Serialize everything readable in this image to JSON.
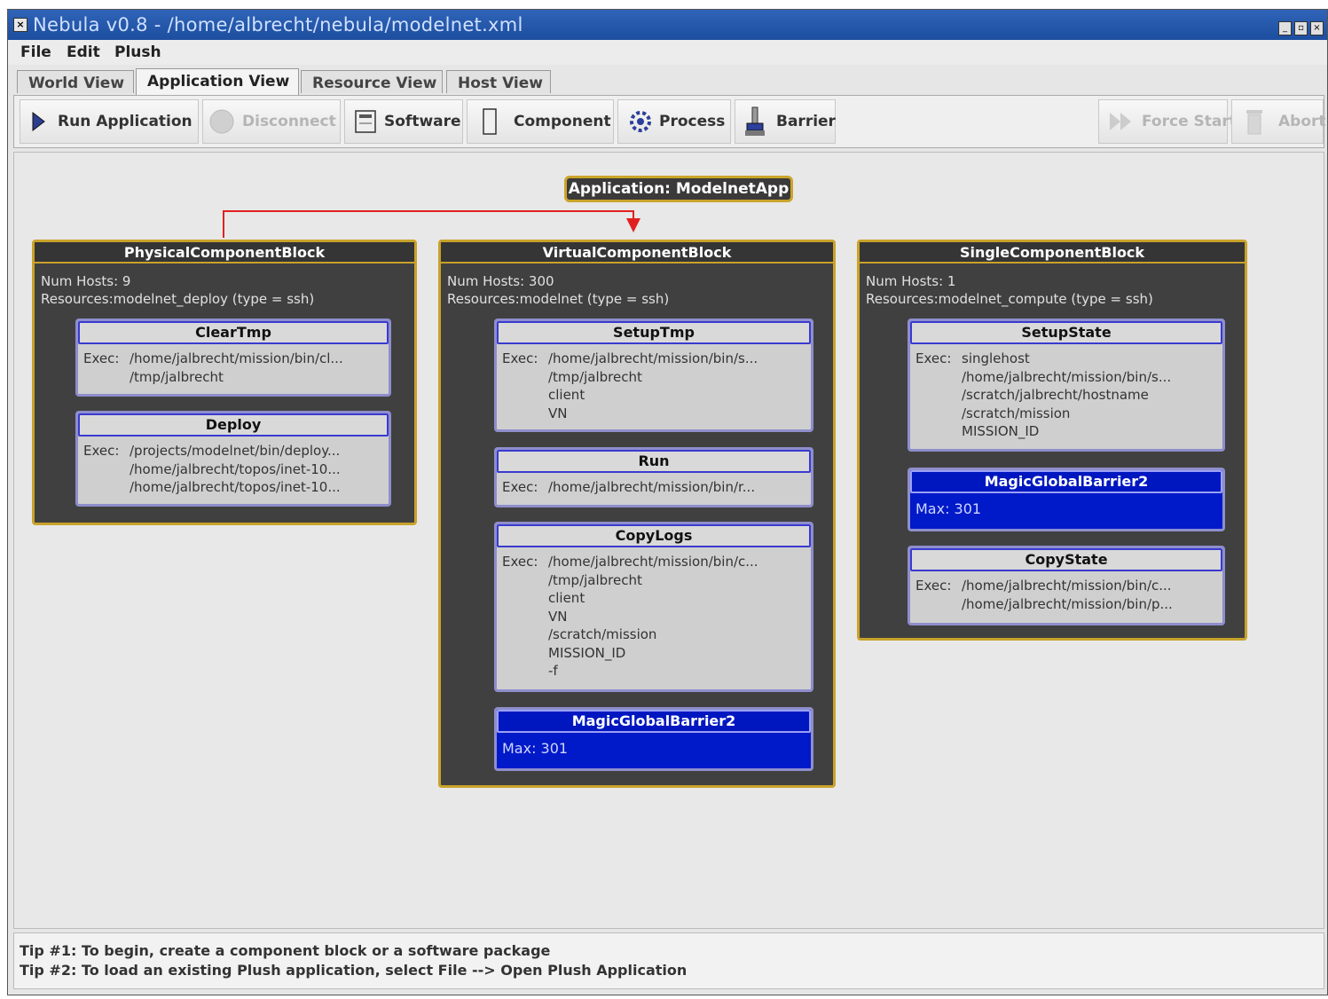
{
  "window": {
    "title": "Nebula v0.8 - /home/albrecht/nebula/modelnet.xml",
    "controls": [
      "_",
      "▫",
      "×"
    ]
  },
  "menu": [
    "File",
    "Edit",
    "Plush"
  ],
  "tabs": [
    {
      "label": "World View",
      "active": false
    },
    {
      "label": "Application View",
      "active": true
    },
    {
      "label": "Resource View",
      "active": false
    },
    {
      "label": "Host View",
      "active": false
    }
  ],
  "toolbar": {
    "run": {
      "label": "Run Application",
      "icon": "play-icon"
    },
    "disconnect": {
      "label": "Disconnect",
      "icon": "disconnect-icon"
    },
    "software": {
      "label": "Software",
      "icon": "software-icon"
    },
    "component": {
      "label": "Component",
      "icon": "component-icon"
    },
    "process": {
      "label": "Process",
      "icon": "gears-icon"
    },
    "barrier": {
      "label": "Barrier",
      "icon": "barrier-icon"
    },
    "force_start": {
      "label": "Force Start",
      "icon": "fast-forward-icon"
    },
    "abort": {
      "label": "Abort",
      "icon": "trash-icon"
    }
  },
  "colors": {
    "block_border": "#c9a22a",
    "block_bg": "#404040",
    "barrier_bg": "#0019c9",
    "link_red": "#e02020",
    "link_yellow": "#e6df2a"
  },
  "application": {
    "label": "Application: ModelnetApp"
  },
  "blocks": {
    "physical": {
      "title": "PhysicalComponentBlock",
      "hosts": "Num Hosts: 9",
      "resources": "Resources:modelnet_deploy (type = ssh)",
      "components": {
        "cleartmp": {
          "title": "ClearTmp",
          "exec_label": "Exec:",
          "lines": [
            "/home/jalbrecht/mission/bin/cl...",
            "/tmp/jalbrecht"
          ]
        },
        "deploy": {
          "title": "Deploy",
          "exec_label": "Exec:",
          "lines": [
            "/projects/modelnet/bin/deploy...",
            "/home/jalbrecht/topos/inet-10...",
            "/home/jalbrecht/topos/inet-10..."
          ]
        }
      }
    },
    "virtual": {
      "title": "VirtualComponentBlock",
      "hosts": "Num Hosts: 300",
      "resources": "Resources:modelnet (type = ssh)",
      "components": {
        "setuptmp": {
          "title": "SetupTmp",
          "exec_label": "Exec:",
          "lines": [
            "/home/jalbrecht/mission/bin/s...",
            "/tmp/jalbrecht",
            "client",
            "VN"
          ]
        },
        "run": {
          "title": "Run",
          "exec_label": "Exec:",
          "lines": [
            "/home/jalbrecht/mission/bin/r..."
          ]
        },
        "copylogs": {
          "title": "CopyLogs",
          "exec_label": "Exec:",
          "lines": [
            "/home/jalbrecht/mission/bin/c...",
            "/tmp/jalbrecht",
            "client",
            "VN",
            "/scratch/mission",
            "MISSION_ID",
            "-f"
          ]
        },
        "barrier": {
          "title": "MagicGlobalBarrier2",
          "max": "Max: 301"
        }
      }
    },
    "single": {
      "title": "SingleComponentBlock",
      "hosts": "Num Hosts: 1",
      "resources": "Resources:modelnet_compute (type = ssh)",
      "components": {
        "setupstate": {
          "title": "SetupState",
          "exec_label": "Exec:",
          "lines": [
            "singlehost",
            "/home/jalbrecht/mission/bin/s...",
            "/scratch/jalbrecht/hostname",
            "/scratch/mission",
            "MISSION_ID"
          ]
        },
        "barrier": {
          "title": "MagicGlobalBarrier2",
          "max": "Max: 301"
        },
        "copystate": {
          "title": "CopyState",
          "exec_label": "Exec:",
          "lines": [
            "/home/jalbrecht/mission/bin/c...",
            "/home/jalbrecht/mission/bin/p..."
          ]
        }
      }
    }
  },
  "tips": [
    "Tip #1: To begin, create a component block or a software package",
    "Tip #2: To load an existing Plush application, select File --> Open Plush Application"
  ]
}
